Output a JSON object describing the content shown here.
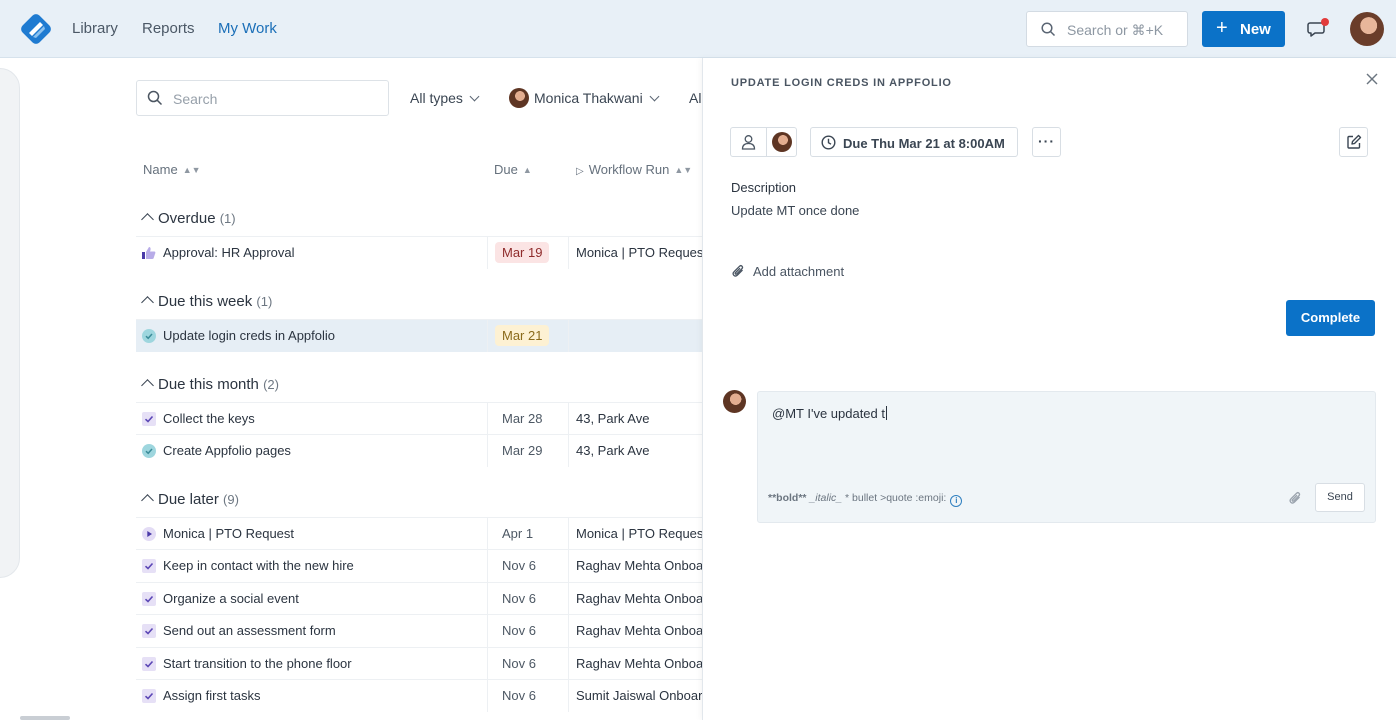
{
  "topbar": {
    "nav": [
      "Library",
      "Reports",
      "My Work"
    ],
    "active_nav": "My Work",
    "search_placeholder": "Search or ⌘+K",
    "new_label": "New",
    "accent": "#0b72c8"
  },
  "list": {
    "search_placeholder": "Search",
    "filters": {
      "types": "All types",
      "assignee": "Monica Thakwani",
      "more": "Al"
    },
    "columns": {
      "name": "Name",
      "due": "Due",
      "workflow": "Workflow Run"
    },
    "groups": [
      {
        "title": "Overdue",
        "count": "(1)"
      },
      {
        "title": "Due this week",
        "count": "(1)"
      },
      {
        "title": "Due this month",
        "count": "(2)"
      },
      {
        "title": "Due later",
        "count": "(9)"
      }
    ],
    "rows": [
      {
        "icon": "thumbs-up-icon",
        "name": "Approval: HR Approval",
        "due": "Mar 19",
        "workflow": "Monica | PTO Request"
      },
      {
        "icon": "check-circle-icon",
        "name": "Update login creds in Appfolio",
        "due": "Mar 21",
        "workflow": ""
      },
      {
        "icon": "checkbox-icon",
        "name": "Collect the keys",
        "due": "Mar 28",
        "workflow": "43, Park Ave"
      },
      {
        "icon": "check-circle-icon",
        "name": "Create Appfolio pages",
        "due": "Mar 29",
        "workflow": "43, Park Ave"
      },
      {
        "icon": "play-circle-icon",
        "name": "Monica | PTO Request",
        "due": "Apr 1",
        "workflow": "Monica | PTO Request"
      },
      {
        "icon": "checkbox-icon",
        "name": "Keep in contact with the new hire",
        "due": "Nov 6",
        "workflow": "Raghav Mehta Onboarding"
      },
      {
        "icon": "checkbox-icon",
        "name": "Organize a social event",
        "due": "Nov 6",
        "workflow": "Raghav Mehta Onboarding"
      },
      {
        "icon": "checkbox-icon",
        "name": "Send out an assessment form",
        "due": "Nov 6",
        "workflow": "Raghav Mehta Onboarding"
      },
      {
        "icon": "checkbox-icon",
        "name": "Start transition to the phone floor",
        "due": "Nov 6",
        "workflow": "Raghav Mehta Onboarding"
      },
      {
        "icon": "checkbox-icon",
        "name": "Assign first tasks",
        "due": "Nov 6",
        "workflow": "Sumit Jaiswal Onboarding"
      }
    ]
  },
  "detail": {
    "title": "UPDATE LOGIN CREDS IN APPFOLIO",
    "due_label": "Due Thu Mar 21 at 8:00AM",
    "description_label": "Description",
    "description": "Update MT once done",
    "attach_label": "Add attachment",
    "complete_label": "Complete",
    "comment_text": "@MT I've updated t",
    "md_hint_bold": "**bold**",
    "md_hint_italic": "_italic_",
    "md_hint_rest": "* bullet >quote :emoji:",
    "send_label": "Send"
  }
}
